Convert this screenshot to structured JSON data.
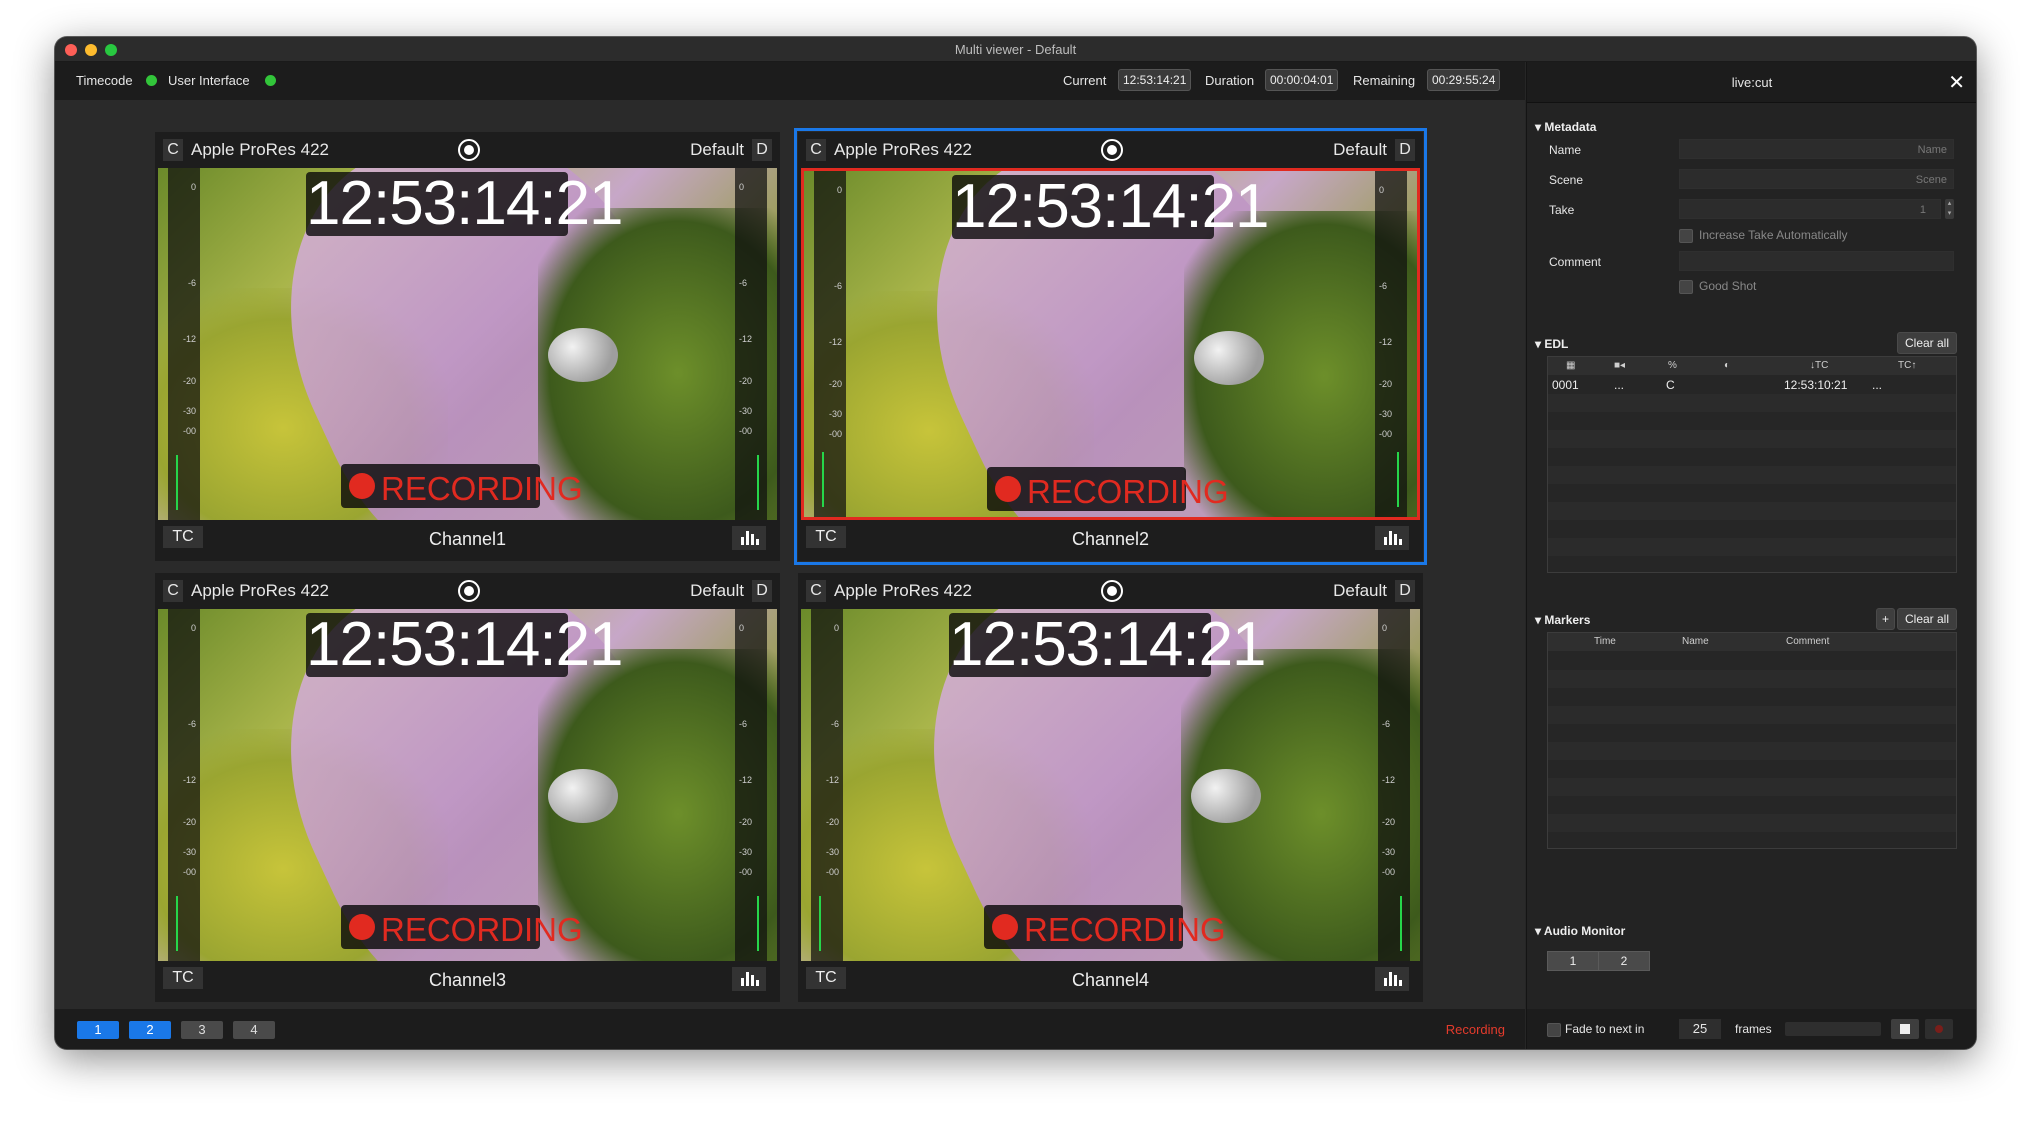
{
  "window": {
    "title": "Multi viewer - Default",
    "traffic_colors": [
      "#fe5f57",
      "#febc2e",
      "#28c840"
    ]
  },
  "topbar": {
    "timecode_label": "Timecode",
    "ui_label": "User Interface",
    "status_color": "#32c53a",
    "current_label": "Current",
    "current_value": "12:53:14:21",
    "duration_label": "Duration",
    "duration_value": "00:00:04:01",
    "remaining_label": "Remaining",
    "remaining_value": "00:29:55:24"
  },
  "channels": [
    {
      "c": "C",
      "codec": "Apple ProRes 422",
      "preset": "Default",
      "d": "D",
      "timecode": "12:53:14:21",
      "recording": "RECORDING",
      "tc": "TC",
      "name": "Channel1",
      "selected": false
    },
    {
      "c": "C",
      "codec": "Apple ProRes 422",
      "preset": "Default",
      "d": "D",
      "timecode": "12:53:14:21",
      "recording": "RECORDING",
      "tc": "TC",
      "name": "Channel2",
      "selected": true
    },
    {
      "c": "C",
      "codec": "Apple ProRes 422",
      "preset": "Default",
      "d": "D",
      "timecode": "12:53:14:21",
      "recording": "RECORDING",
      "tc": "TC",
      "name": "Channel3",
      "selected": false
    },
    {
      "c": "C",
      "codec": "Apple ProRes 422",
      "preset": "Default",
      "d": "D",
      "timecode": "12:53:14:21",
      "recording": "RECORDING",
      "tc": "TC",
      "name": "Channel4",
      "selected": false
    }
  ],
  "meter_ticks": [
    "0",
    "-6",
    "-12",
    "-20",
    "-30",
    "-00"
  ],
  "bottombar": {
    "pages": [
      {
        "label": "1",
        "active": true
      },
      {
        "label": "2",
        "active": true
      },
      {
        "label": "3",
        "active": false
      },
      {
        "label": "4",
        "active": false
      }
    ],
    "status": "Recording"
  },
  "sidebar": {
    "title": "live:cut",
    "metadata": {
      "section": "Metadata",
      "name_label": "Name",
      "name_placeholder": "Name",
      "scene_label": "Scene",
      "scene_placeholder": "Scene",
      "take_label": "Take",
      "take_value": "1",
      "increase_take_label": "Increase Take Automatically",
      "comment_label": "Comment",
      "good_shot_label": "Good Shot"
    },
    "edl": {
      "section": "EDL",
      "clear_label": "Clear all",
      "headers": [
        "%",
        "↓TC",
        "TC↑"
      ],
      "rows": [
        {
          "num": "0001",
          "cam": "...",
          "tr": "C",
          "tc_in": "12:53:10:21",
          "tc_out": "..."
        }
      ]
    },
    "markers": {
      "section": "Markers",
      "add_label": "+",
      "clear_label": "Clear all",
      "headers": [
        "Time",
        "Name",
        "Comment"
      ]
    },
    "audio": {
      "section": "Audio Monitor",
      "channels": [
        "1",
        "2"
      ]
    },
    "footer": {
      "fade_label": "Fade to next in",
      "frames_value": "25",
      "frames_label": "frames"
    }
  },
  "colors": {
    "accent": "#1a78e8",
    "record": "#e12a20",
    "meter": "#26d64a"
  }
}
